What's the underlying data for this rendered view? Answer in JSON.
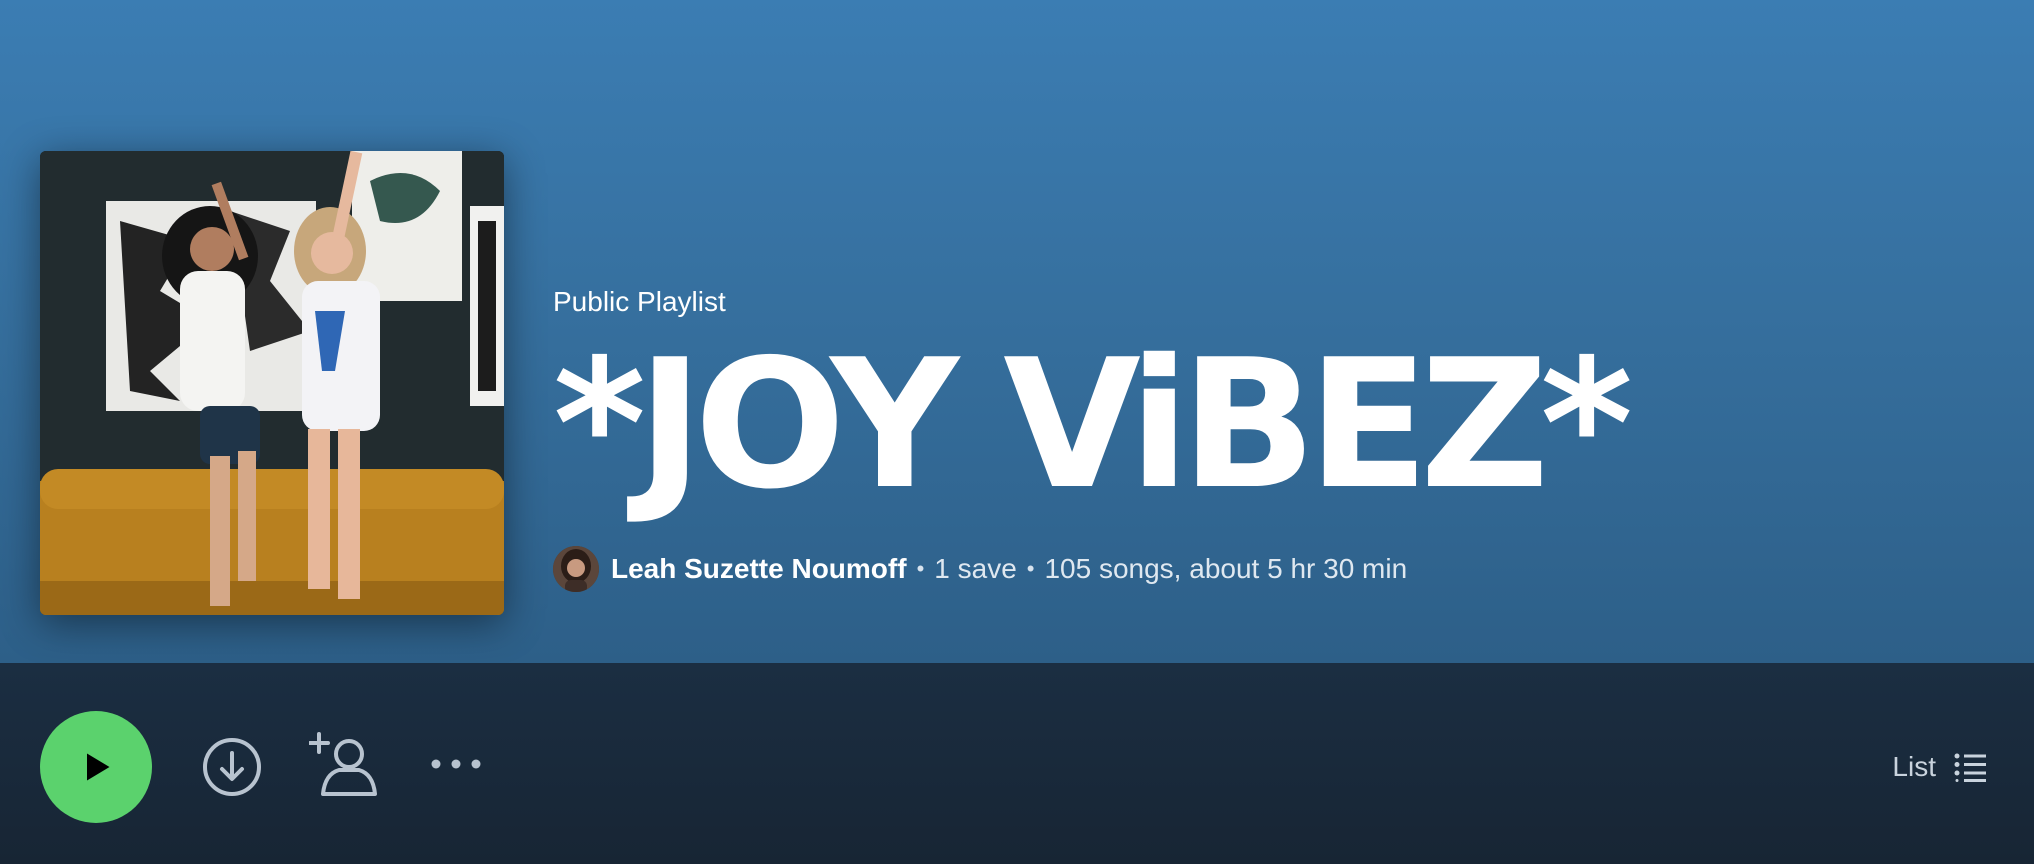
{
  "playlist": {
    "type_label": "Public Playlist",
    "title": "*JOY ViBEZ*",
    "owner": "Leah Suzette Noumoff",
    "saves": "1 save",
    "stats": "105 songs, about 5 hr 30 min",
    "separator": "•"
  },
  "actions": {
    "view_label": "List"
  },
  "icons": {
    "play": "play-icon",
    "download": "download-icon",
    "follow": "add-user-icon",
    "more": "more-dots-icon",
    "list": "list-view-icon"
  },
  "colors": {
    "hero_top": "#3b7db3",
    "hero_bottom": "#2d5f88",
    "actionbar": "#1b2e42",
    "play_green": "#5bd26d"
  }
}
